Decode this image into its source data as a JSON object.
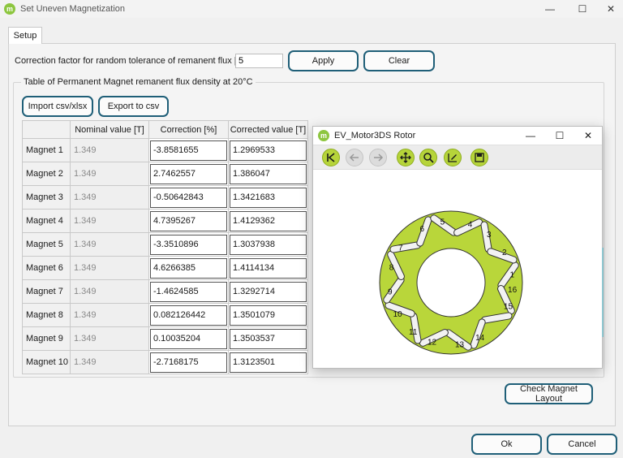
{
  "window": {
    "title": "Set Uneven Magnetization",
    "logo": "m"
  },
  "tabs": [
    "Setup"
  ],
  "correction": {
    "label": "Correction factor for random tolerance of remanent flux [%]",
    "value": "5",
    "apply_label": "Apply",
    "clear_label": "Clear"
  },
  "table_group": {
    "title": "Table of Permanent Magnet remanent flux density at 20°C",
    "import_label": "Import csv/xlsx",
    "export_label": "Export to csv"
  },
  "table": {
    "columns": [
      "Nominal value [T]",
      "Correction [%]",
      "Corrected value [T]"
    ],
    "rows": [
      {
        "name": "Magnet 1",
        "nominal": "1.349",
        "correction": "-3.8581655",
        "corrected": "1.2969533"
      },
      {
        "name": "Magnet 2",
        "nominal": "1.349",
        "correction": "2.7462557",
        "corrected": "1.386047"
      },
      {
        "name": "Magnet 3",
        "nominal": "1.349",
        "correction": "-0.50642843",
        "corrected": "1.3421683"
      },
      {
        "name": "Magnet 4",
        "nominal": "1.349",
        "correction": "4.7395267",
        "corrected": "1.4129362"
      },
      {
        "name": "Magnet 5",
        "nominal": "1.349",
        "correction": "-3.3510896",
        "corrected": "1.3037938"
      },
      {
        "name": "Magnet 6",
        "nominal": "1.349",
        "correction": "4.6266385",
        "corrected": "1.4114134"
      },
      {
        "name": "Magnet 7",
        "nominal": "1.349",
        "correction": "-1.4624585",
        "corrected": "1.3292714"
      },
      {
        "name": "Magnet 8",
        "nominal": "1.349",
        "correction": "0.082126442",
        "corrected": "1.3501079"
      },
      {
        "name": "Magnet 9",
        "nominal": "1.349",
        "correction": "0.10035204",
        "corrected": "1.3503537"
      },
      {
        "name": "Magnet 10",
        "nominal": "1.349",
        "correction": "-2.7168175",
        "corrected": "1.3123501"
      }
    ]
  },
  "check_layout_label": "Check Magnet Layout",
  "rotor_window": {
    "title": "EV_Motor3DS Rotor",
    "toolbar": [
      "home-icon",
      "back-arrow-icon",
      "forward-arrow-icon",
      "pan-icon",
      "zoom-icon",
      "edit-axes-icon",
      "save-icon"
    ],
    "magnet_labels": [
      "1",
      "2",
      "3",
      "4",
      "5",
      "6",
      "7",
      "8",
      "9",
      "10",
      "11",
      "12",
      "13",
      "14",
      "15",
      "16"
    ],
    "colors": {
      "rotor": "#b9d63a",
      "magnet": "#f2f2f2",
      "outline": "#333333"
    }
  },
  "footer": {
    "ok_label": "Ok",
    "cancel_label": "Cancel"
  },
  "colors": {
    "accent_border": "#1f5f78",
    "brand_green": "#8dc63f"
  }
}
